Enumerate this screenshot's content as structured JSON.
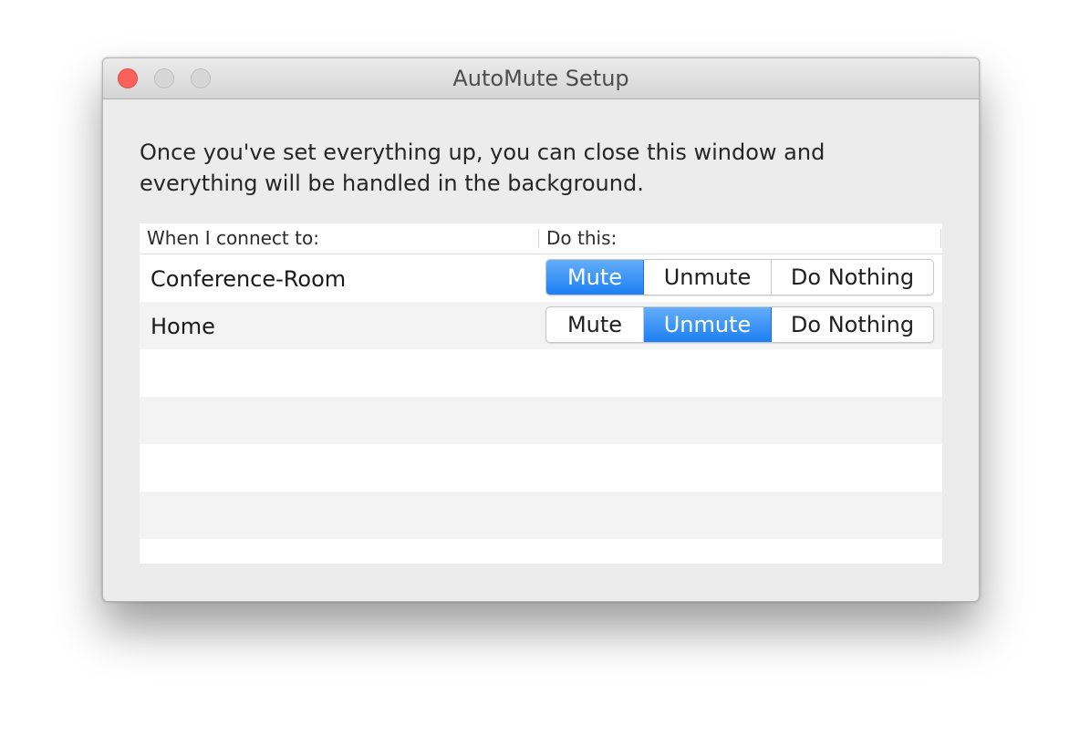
{
  "window": {
    "title": "AutoMute Setup"
  },
  "intro": {
    "line1": "Once you've set everything up, you can close this window and",
    "line2": "everything will be handled in the background."
  },
  "table": {
    "columns": [
      "When I connect to:",
      "Do this:"
    ],
    "options": [
      "Mute",
      "Unmute",
      "Do Nothing"
    ],
    "rows": [
      {
        "network": "Conference-Room",
        "selected": "Mute"
      },
      {
        "network": "Home",
        "selected": "Unmute"
      }
    ],
    "empty_rows": 5
  },
  "colors": {
    "accent": "#1c7ff3",
    "close_button": "#fc605b"
  }
}
